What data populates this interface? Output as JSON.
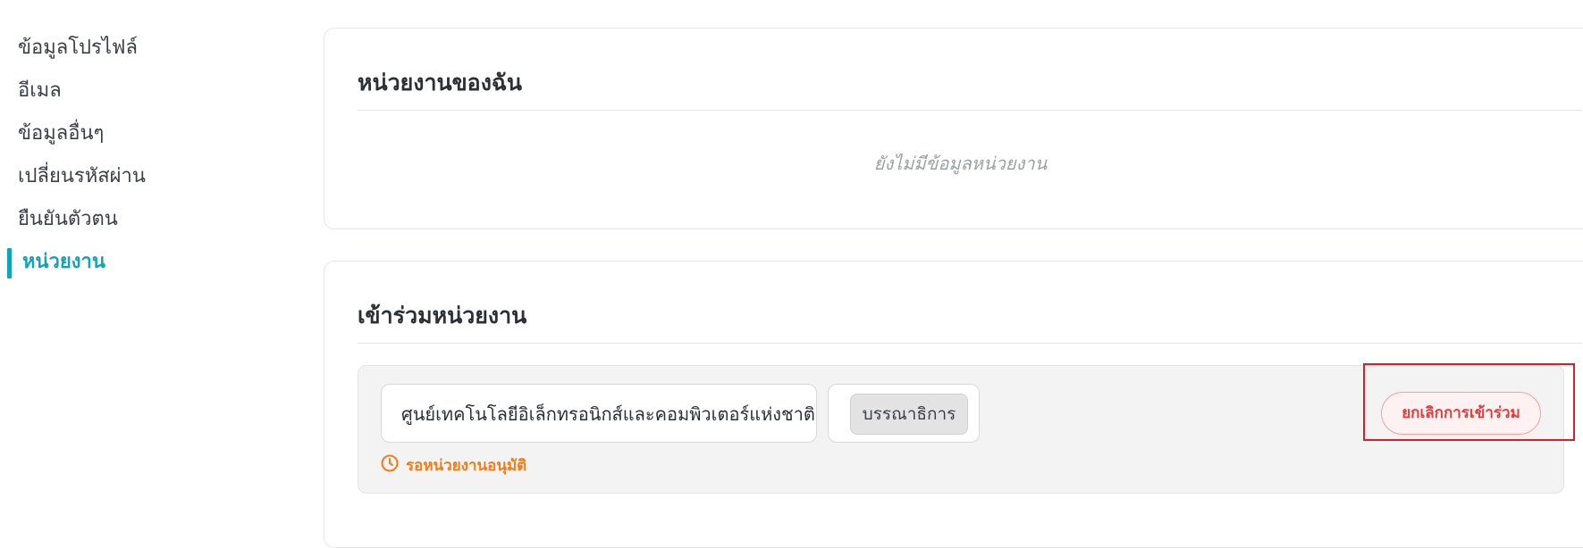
{
  "sidebar": {
    "items": [
      {
        "label": "ข้อมูลโปรไฟล์"
      },
      {
        "label": "อีเมล"
      },
      {
        "label": "ข้อมูลอื่นๆ"
      },
      {
        "label": "เปลี่ยนรหัสผ่าน"
      },
      {
        "label": "ยืนยันตัวตน"
      },
      {
        "label": "หน่วยงาน"
      }
    ],
    "active_index": 5
  },
  "my_units": {
    "title": "หน่วยงานของฉัน",
    "empty_message": "ยังไม่มีข้อมูลหน่วยงาน"
  },
  "join_units": {
    "title": "เข้าร่วมหน่วยงาน",
    "membership": {
      "organization": "ศูนย์เทคโนโลยีอิเล็กทรอนิกส์และคอมพิวเตอร์แห่งชาติ",
      "role": "บรรณาธิการ",
      "status": "รอหน่วยงานอนุมัติ",
      "cancel_label": "ยกเลิกการเข้าร่วม"
    }
  },
  "colors": {
    "accent": "#14a3b4",
    "pending": "#ef7d1a",
    "danger": "#e03c3c",
    "highlight": "#d81f2a"
  },
  "icons": {
    "pending": "clock-icon"
  }
}
